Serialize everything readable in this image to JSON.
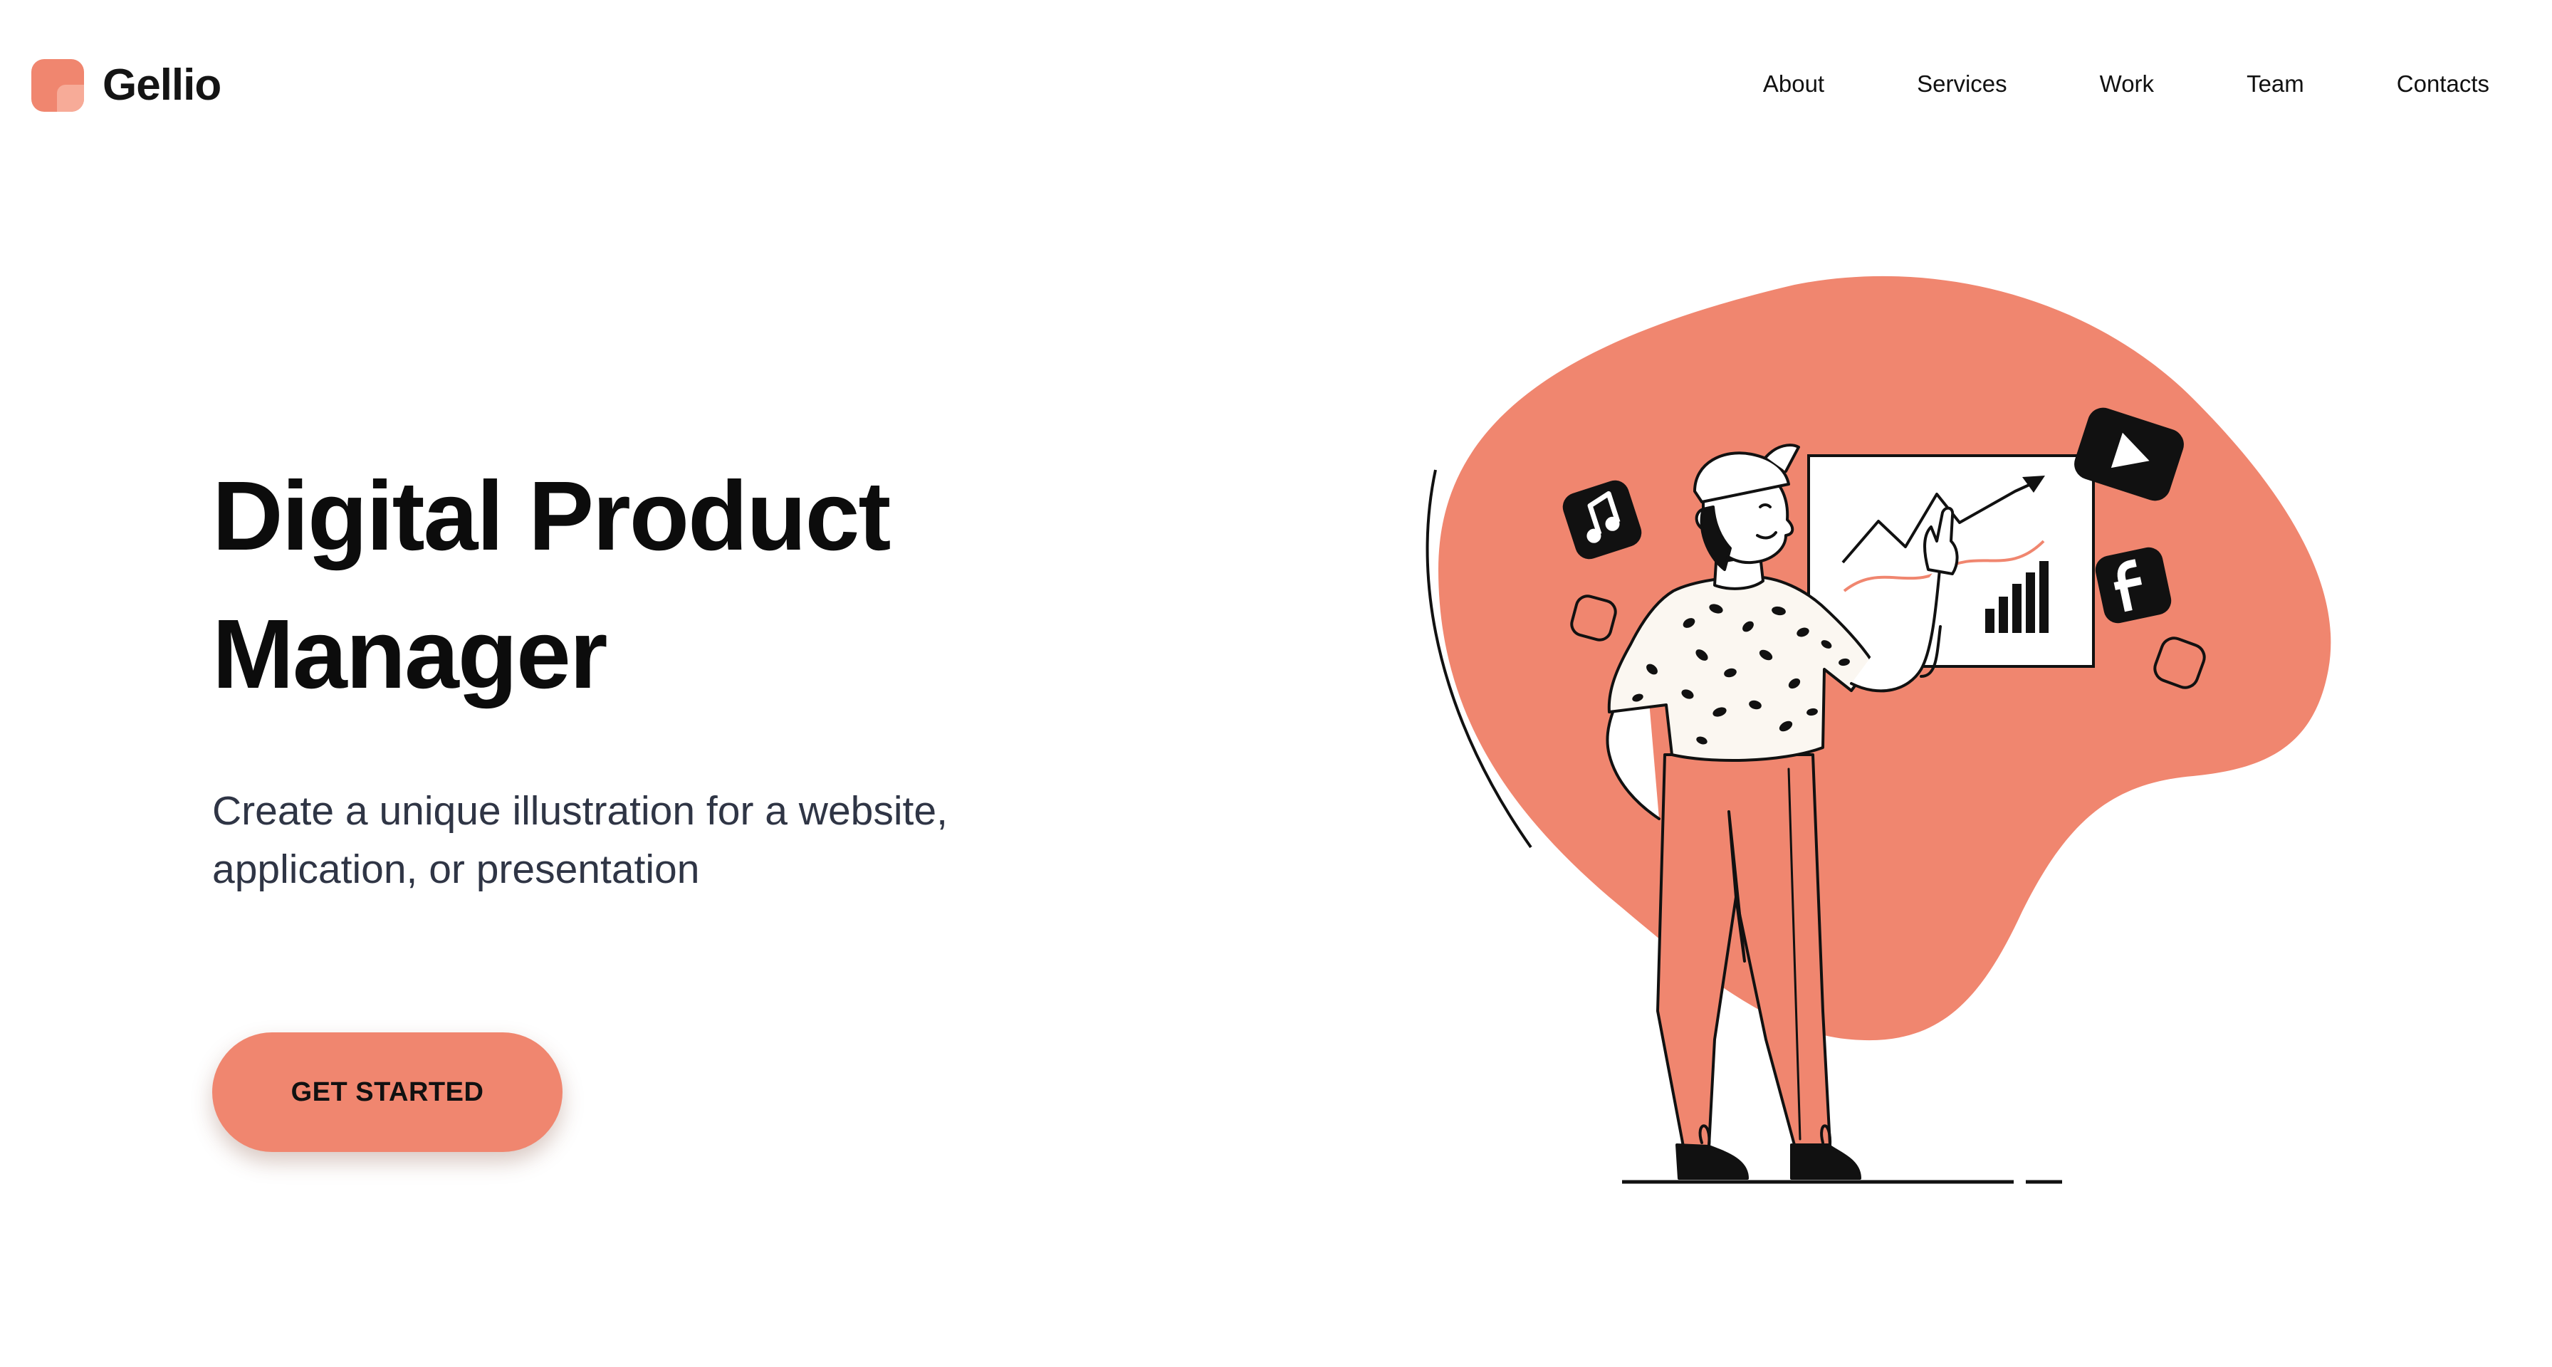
{
  "brand": {
    "name": "Gellio",
    "logo_icon": "gellio-logo-icon",
    "accent_color": "#f0866f",
    "accent_light": "#f7ab98"
  },
  "nav": {
    "items": [
      {
        "label": "About"
      },
      {
        "label": "Services"
      },
      {
        "label": "Work"
      },
      {
        "label": "Team"
      },
      {
        "label": "Contacts"
      }
    ]
  },
  "hero": {
    "title_line1": "Digital Product",
    "title_line2": "Manager",
    "subtitle_line1": "Create a unique illustration for a website,",
    "subtitle_line2": "application, or presentation",
    "cta_label": "GET STARTED"
  },
  "illustration": {
    "icons": [
      "music-note-icon",
      "play-icon",
      "facebook-icon",
      "bar-chart-icon",
      "trend-arrow-icon"
    ],
    "blob_color": "#f0866f"
  }
}
